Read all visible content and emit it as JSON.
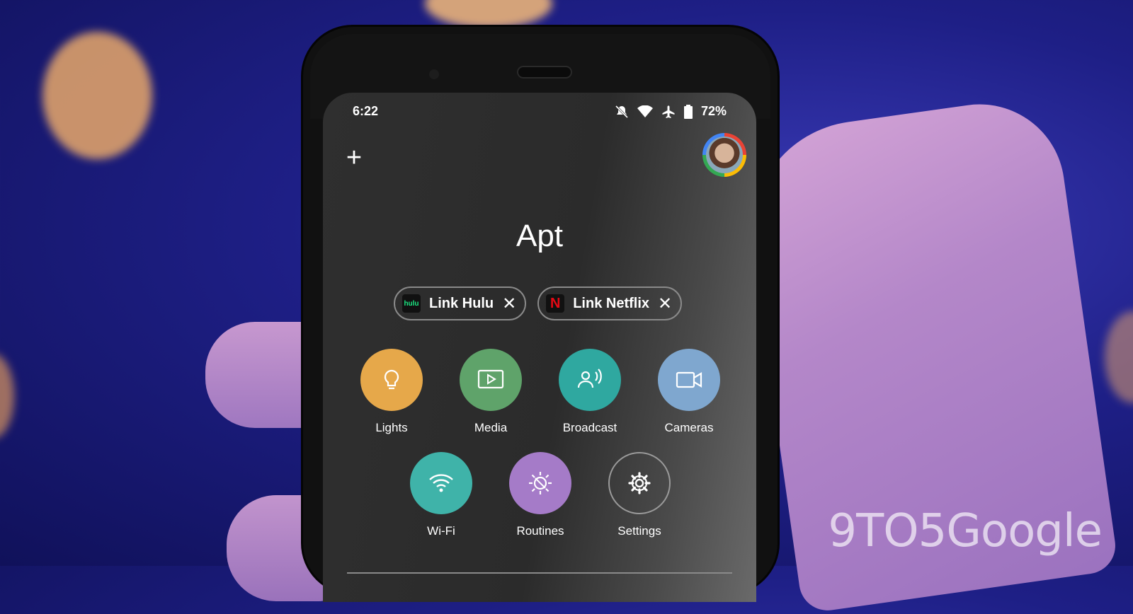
{
  "status_bar": {
    "time": "6:22",
    "battery": "72%"
  },
  "header": {
    "add_symbol": "+",
    "home_name": "Apt"
  },
  "chips": [
    {
      "logo_text": "hulu",
      "label": "Link Hulu",
      "close": "✕"
    },
    {
      "logo_text": "N",
      "label": "Link Netflix",
      "close": "✕"
    }
  ],
  "actions": [
    {
      "label": "Lights",
      "color": "#e6a84a",
      "icon": "lightbulb-icon"
    },
    {
      "label": "Media",
      "color": "#5fa36a",
      "icon": "media-icon"
    },
    {
      "label": "Broadcast",
      "color": "#2fa8a0",
      "icon": "broadcast-icon"
    },
    {
      "label": "Cameras",
      "color": "#7fa7cf",
      "icon": "camera-icon"
    },
    {
      "label": "Wi-Fi",
      "color": "#3fb3a9",
      "icon": "wifi-icon"
    },
    {
      "label": "Routines",
      "color": "#a57bc8",
      "icon": "routines-icon"
    },
    {
      "label": "Settings",
      "color": "transparent",
      "icon": "gear-icon"
    }
  ],
  "watermark": "9TO5Google"
}
